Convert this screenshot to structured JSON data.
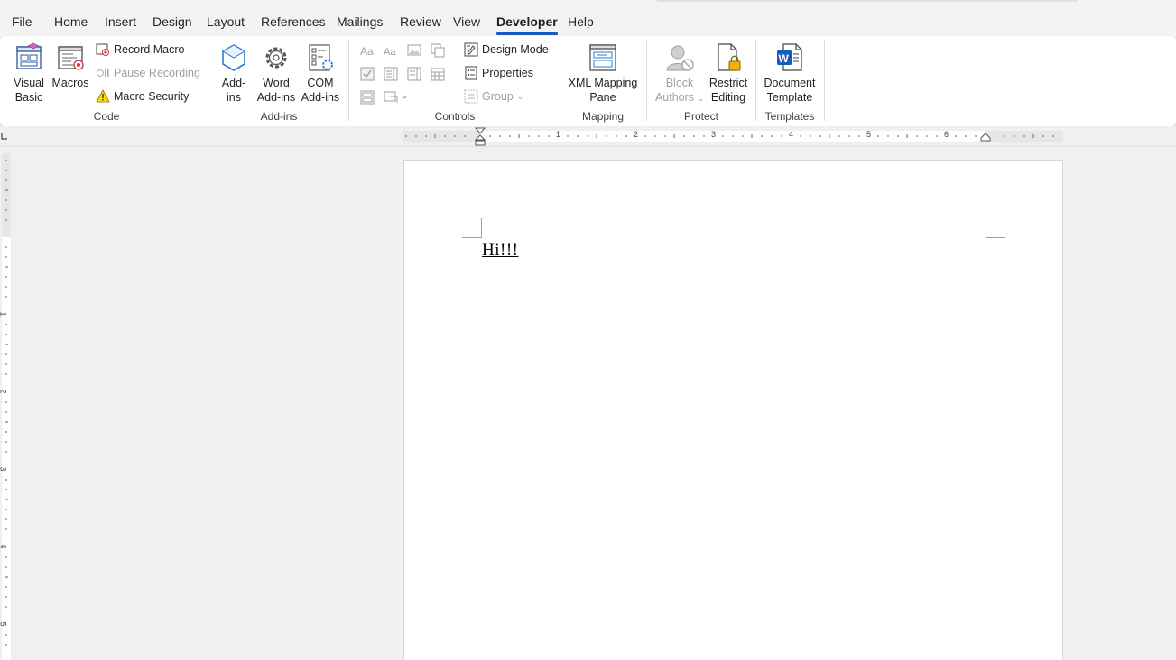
{
  "menu": {
    "tabs": [
      "File",
      "Home",
      "Insert",
      "Design",
      "Layout",
      "References",
      "Mailings",
      "Review",
      "View",
      "Developer",
      "Help"
    ],
    "active": "Developer"
  },
  "ribbon": {
    "code": {
      "label": "Code",
      "visual_basic_l1": "Visual",
      "visual_basic_l2": "Basic",
      "macros": "Macros",
      "record_macro": "Record Macro",
      "pause_recording": "Pause Recording",
      "macro_security": "Macro Security"
    },
    "addins": {
      "label": "Add-ins",
      "addins_l1": "Add-",
      "addins_l2": "ins",
      "word_l1": "Word",
      "word_l2": "Add-ins",
      "com_l1": "COM",
      "com_l2": "Add-ins"
    },
    "controls": {
      "label": "Controls",
      "design_mode": "Design Mode",
      "properties": "Properties",
      "group": "Group"
    },
    "mapping": {
      "label": "Mapping",
      "xml_l1": "XML Mapping",
      "xml_l2": "Pane"
    },
    "protect": {
      "label": "Protect",
      "block_l1": "Block",
      "block_l2": "Authors",
      "restrict_l1": "Restrict",
      "restrict_l2": "Editing"
    },
    "templates": {
      "label": "Templates",
      "doc_l1": "Document",
      "doc_l2": "Template"
    }
  },
  "ruler": {
    "h_numbers": [
      "1",
      "2",
      "3",
      "4",
      "5",
      "6"
    ],
    "v_numbers": [
      "1",
      "2",
      "3",
      "4",
      "5"
    ]
  },
  "document": {
    "text": "Hi!!!"
  },
  "colors": {
    "accent": "#185abd",
    "ribbon_bg": "#ffffff",
    "app_bg": "#f0f0f0"
  }
}
